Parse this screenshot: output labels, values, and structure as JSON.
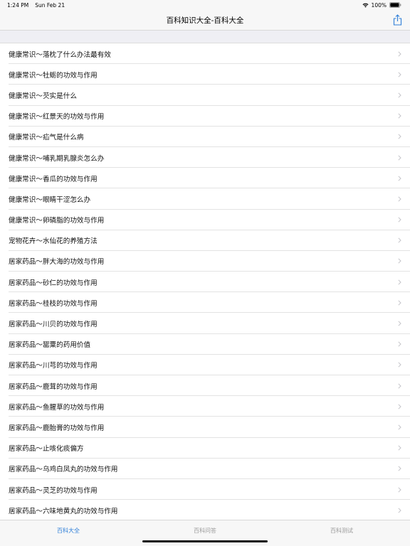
{
  "status_bar": {
    "time": "1:24 PM",
    "date": "Sun Feb 21",
    "battery": "100%"
  },
  "nav": {
    "title": "百科知识大全-百科大全",
    "share_icon": "share-icon"
  },
  "colors": {
    "accent": "#2f7fd8",
    "tab_inactive": "#999999",
    "separator": "#e3e3e3"
  },
  "list": {
    "items": [
      "健康常识～落枕了什么办法最有效",
      "健康常识～牡蛎的功效与作用",
      "健康常识～芡实是什么",
      "健康常识～红景天的功效与作用",
      "健康常识～疝气是什么病",
      "健康常识～哺乳期乳腺炎怎么办",
      "健康常识～香瓜的功效与作用",
      "健康常识～眼睛干涩怎么办",
      "健康常识～卵磷脂的功效与作用",
      "宠物花卉～水仙花的养殖方法",
      "居家药品～胖大海的功效与作用",
      "居家药品～砂仁的功效与作用",
      "居家药品～桂枝的功效与作用",
      "居家药品～川贝的功效与作用",
      "居家药品～罂粟的药用价值",
      "居家药品～川芎的功效与作用",
      "居家药品～鹿茸的功效与作用",
      "居家药品～鱼腥草的功效与作用",
      "居家药品～鹿胎膏的功效与作用",
      "居家药品～止咳化痰偏方",
      "居家药品～乌鸡白凤丸的功效与作用",
      "居家药品～灵芝的功效与作用",
      "居家药品～六味地黄丸的功效与作用"
    ]
  },
  "tabs": [
    {
      "label": "百科大全",
      "active": true
    },
    {
      "label": "百科问答",
      "active": false
    },
    {
      "label": "百科测试",
      "active": false
    }
  ]
}
